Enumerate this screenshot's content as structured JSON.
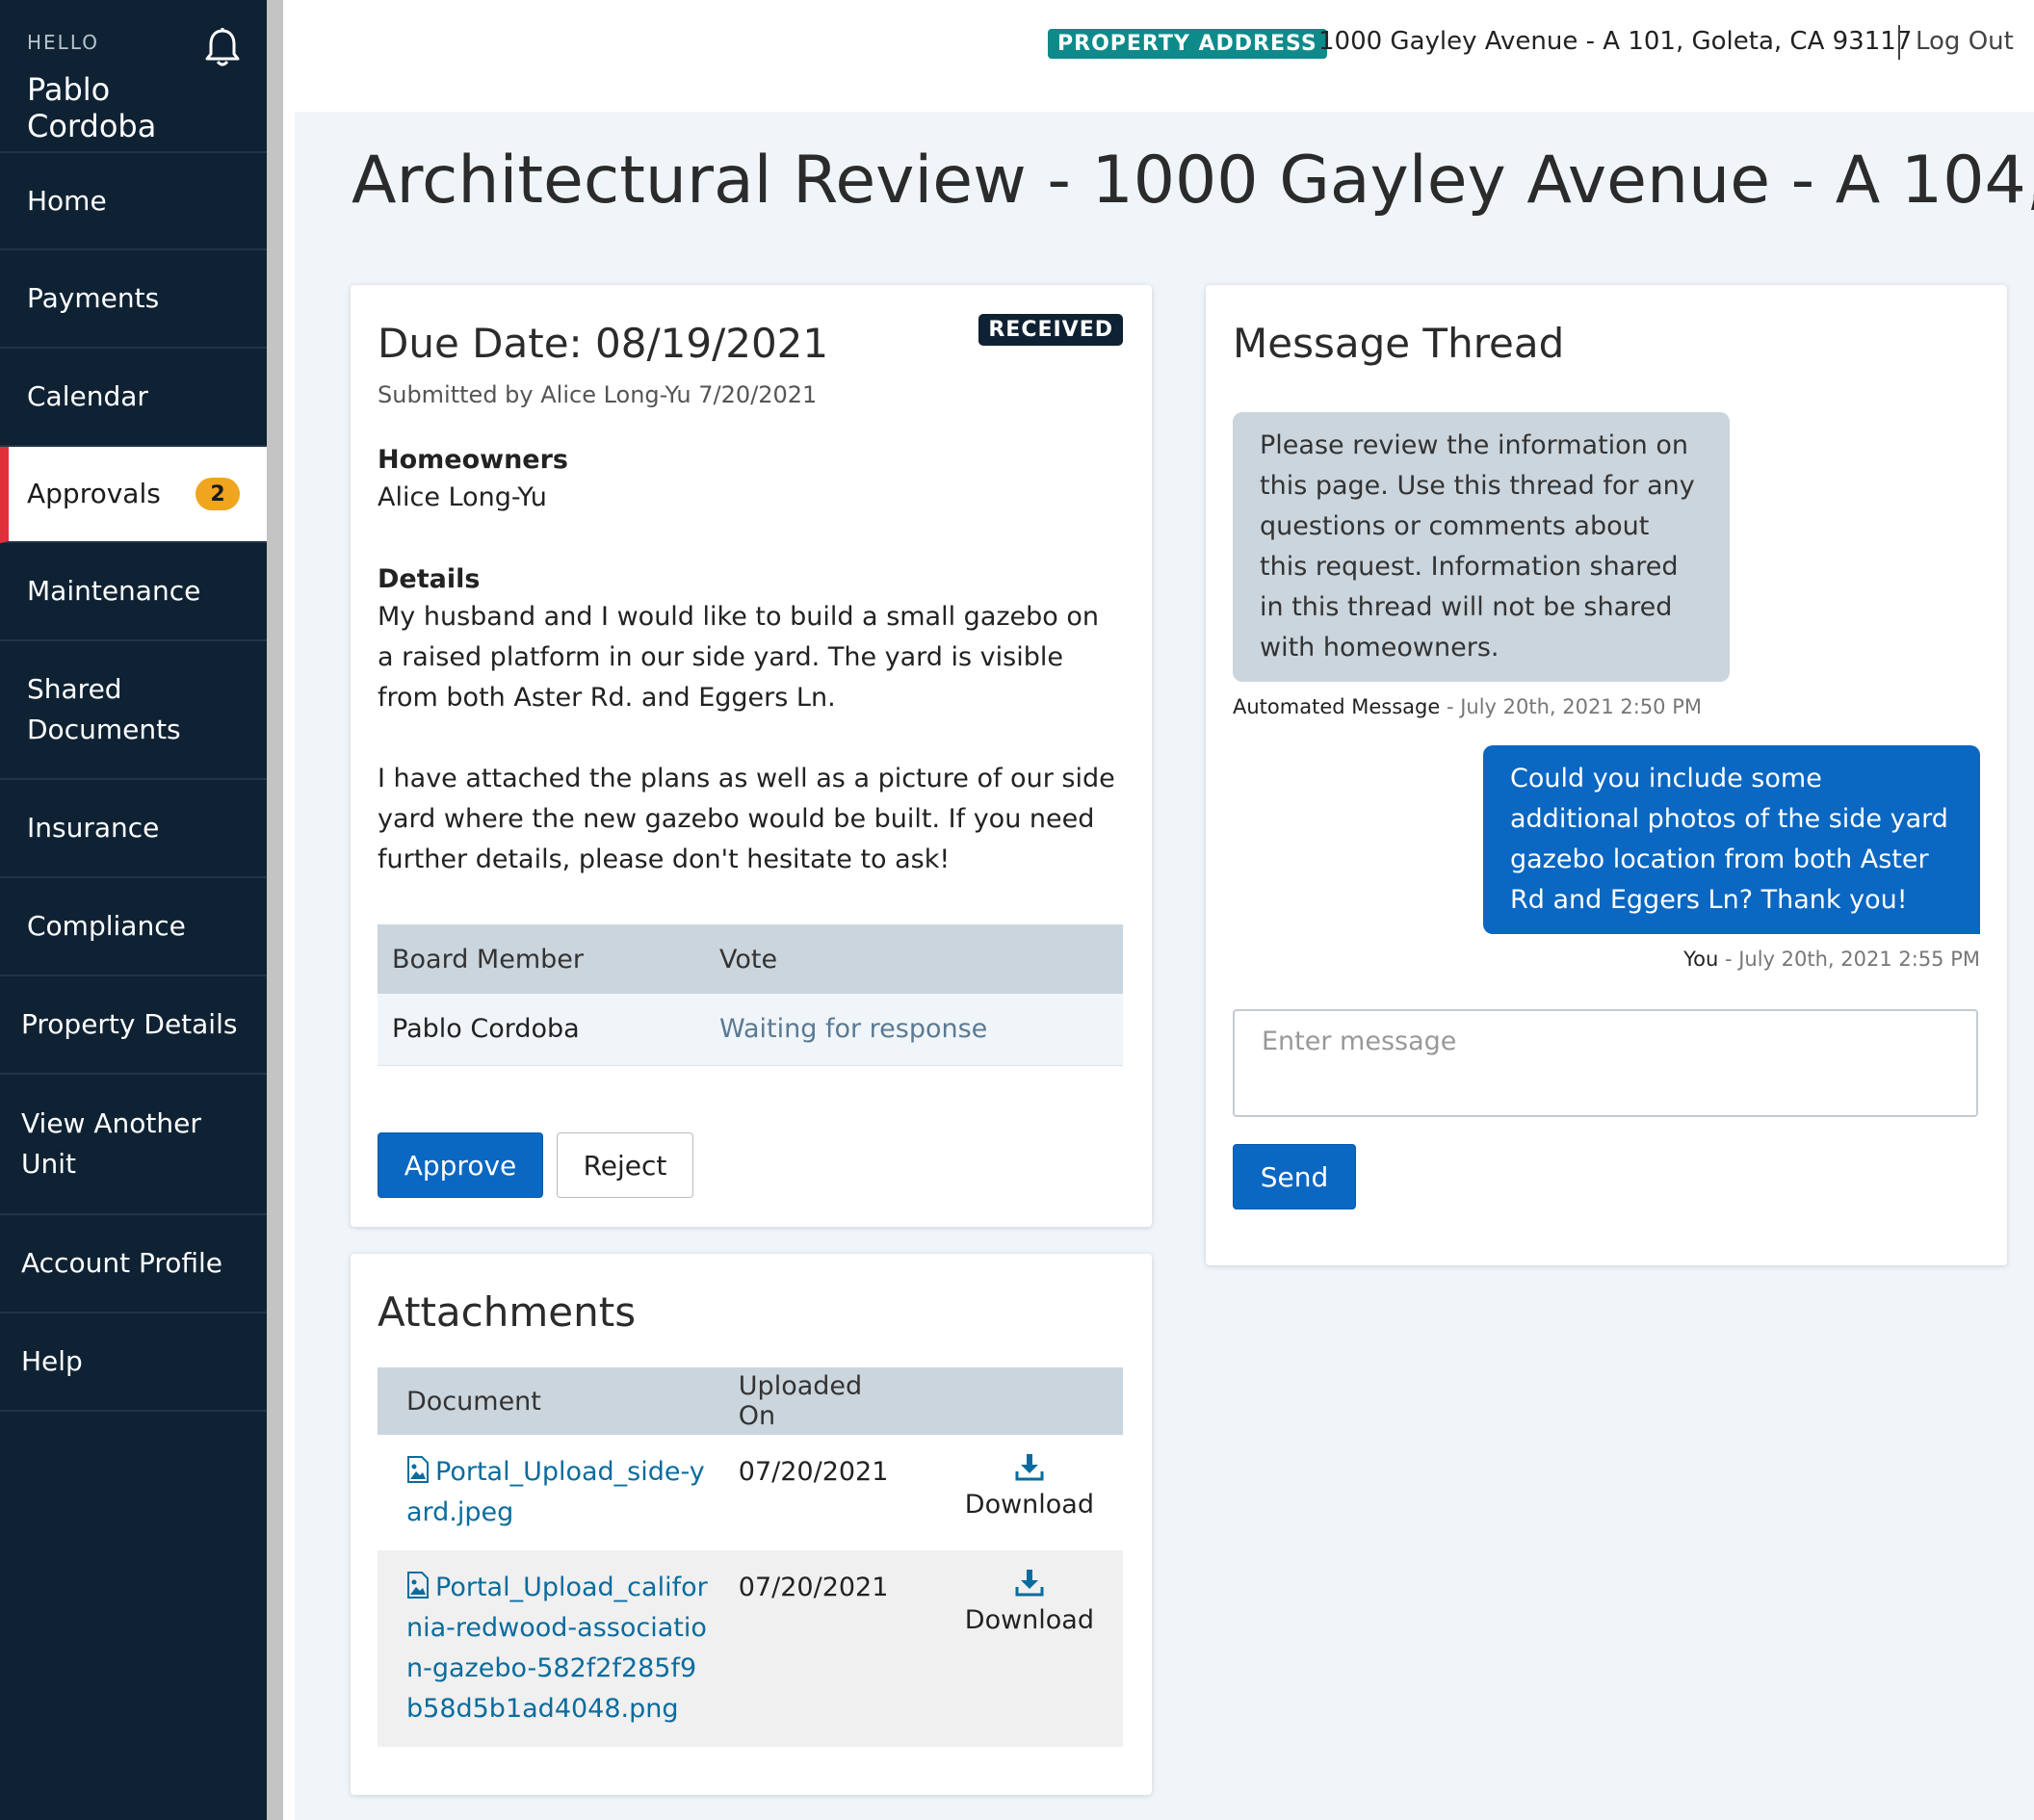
{
  "sidebar": {
    "greeting": "HELLO",
    "user_name": "Pablo Cordoba",
    "items": [
      {
        "label": "Home"
      },
      {
        "label": "Payments"
      },
      {
        "label": "Calendar"
      },
      {
        "label": "Approvals",
        "badge": "2",
        "active": true
      },
      {
        "label": "Maintenance"
      },
      {
        "label": "Shared Documents"
      },
      {
        "label": "Insurance"
      },
      {
        "label": "Compliance"
      },
      {
        "label": "Property Details"
      },
      {
        "label": "View Another Unit"
      },
      {
        "label": "Account Profile"
      },
      {
        "label": "Help"
      }
    ]
  },
  "header": {
    "property_tag": "PROPERTY ADDRESS",
    "property_address": "1000 Gayley Avenue - A 101, Goleta, CA 93117",
    "logout": "Log Out"
  },
  "page": {
    "title": "Architectural Review - 1000 Gayley Avenue - A 104,"
  },
  "request": {
    "due_date": "Due Date: 08/19/2021",
    "status": "RECEIVED",
    "submitted": "Submitted by Alice Long-Yu 7/20/2021",
    "homeowners_heading": "Homeowners",
    "homeowners": "Alice Long-Yu",
    "details_heading": "Details",
    "details_p1": "My husband and I would like to build a small gazebo on a raised platform in our side yard. The yard is visible from both Aster Rd. and Eggers Ln.",
    "details_p2": "I have attached the plans as well as a picture of our side yard where the new gazebo would be built. If you need further details, please don't hesitate to ask!",
    "vote_columns": [
      "Board Member",
      "Vote"
    ],
    "votes": [
      {
        "member": "Pablo Cordoba",
        "vote": "Waiting for response"
      }
    ],
    "approve_label": "Approve",
    "reject_label": "Reject"
  },
  "attachments": {
    "title": "Attachments",
    "columns": [
      "Document",
      "Uploaded On",
      ""
    ],
    "rows": [
      {
        "name": "Portal_Upload_side-yard.jpeg",
        "uploaded": "07/20/2021",
        "action": "Download"
      },
      {
        "name": "Portal_Upload_california-redwood-association-gazebo-582f2f285f9b58d5b1ad4048.png",
        "uploaded": "07/20/2021",
        "action": "Download"
      }
    ]
  },
  "thread": {
    "title": "Message Thread",
    "messages": [
      {
        "text": "Please review the information on this page. Use this thread for any questions or comments about this request. Information shared in this thread will not be shared with homeowners.",
        "author": "Automated Message",
        "time": " - July 20th, 2021 2:50 PM"
      },
      {
        "text": "Could you include some additional photos of the side yard gazebo location from both Aster Rd and Eggers Ln? Thank you!",
        "author": "You",
        "time": " - July 20th, 2021 2:55 PM"
      }
    ],
    "input_placeholder": "Enter message",
    "send_label": "Send"
  },
  "colors": {
    "sidebar_bg": "#0f2233",
    "accent_blue": "#0a67c2",
    "active_marker": "#e0303a",
    "badge": "#f0a51e",
    "property_tag": "#0f8a8a",
    "link": "#0a6c9e"
  }
}
